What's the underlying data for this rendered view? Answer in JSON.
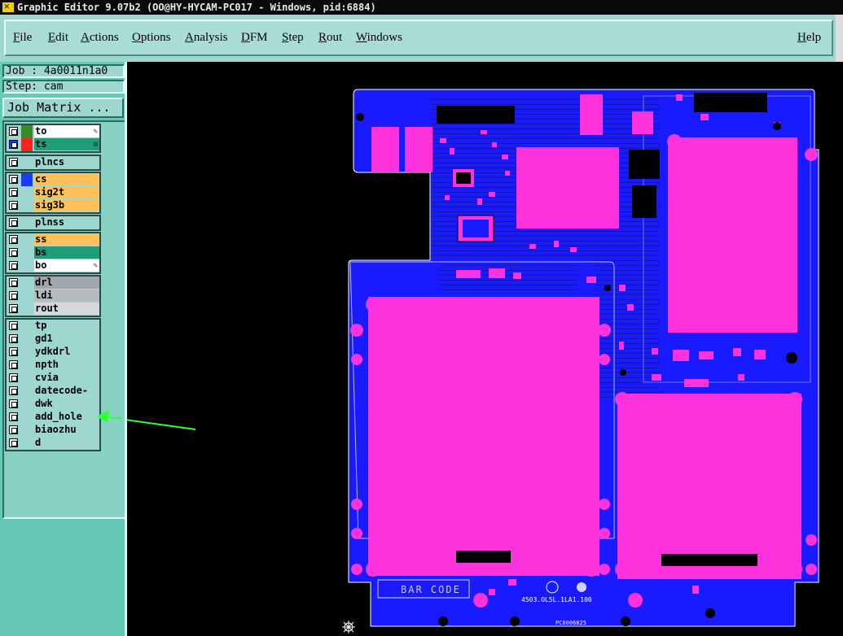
{
  "window": {
    "title": "Graphic Editor 9.07b2 (OO@HY-HYCAM-PC017 - Windows, pid:6884)"
  },
  "menu": {
    "items": [
      "File",
      "Edit",
      "Actions",
      "Options",
      "Analysis",
      "DFM",
      "Step",
      "Rout",
      "Windows"
    ],
    "help": "Help"
  },
  "panel": {
    "job": "Job : 4a0011n1a0",
    "step": "Step: cam",
    "job_matrix": "Job Matrix ..."
  },
  "layer_groups": [
    {
      "layers": [
        {
          "name": "to",
          "swatch": "#3a8a2a",
          "bg": "#ffffff",
          "mark": "✎"
        },
        {
          "name": "ts",
          "swatch": "#ff2020",
          "bg": "#1e9e78",
          "mark": "⊞",
          "selected": true
        }
      ]
    },
    {
      "layers": [
        {
          "name": "plncs",
          "swatch": "",
          "bg": "#9ed6d0"
        }
      ]
    },
    {
      "layers": [
        {
          "name": "cs",
          "swatch": "#1a3cff",
          "bg": "#ffc25a"
        },
        {
          "name": "sig2t",
          "swatch": "",
          "bg": "#ffc25a"
        },
        {
          "name": "sig3b",
          "swatch": "",
          "bg": "#ffc25a"
        }
      ]
    },
    {
      "layers": [
        {
          "name": "plnss",
          "swatch": "",
          "bg": "#9ed6d0"
        }
      ]
    },
    {
      "layers": [
        {
          "name": "ss",
          "swatch": "",
          "bg": "#ffc25a"
        },
        {
          "name": "bs",
          "swatch": "",
          "bg": "#1e9e78"
        },
        {
          "name": "bo",
          "swatch": "",
          "bg": "#ffffff",
          "mark": "✎"
        }
      ]
    },
    {
      "layers": [
        {
          "name": "drl",
          "swatch": "",
          "bg": "#9ea8ac"
        },
        {
          "name": "ldi",
          "swatch": "",
          "bg": "#b4bcc0"
        },
        {
          "name": "rout",
          "swatch": "",
          "bg": "#d4d8d8"
        }
      ]
    },
    {
      "layers": [
        {
          "name": "tp",
          "swatch": "",
          "bg": "#9ed6d0"
        },
        {
          "name": "gd1",
          "swatch": "",
          "bg": "#9ed6d0"
        },
        {
          "name": "ydkdrl",
          "swatch": "",
          "bg": "#9ed6d0"
        },
        {
          "name": "npth",
          "swatch": "",
          "bg": "#9ed6d0"
        },
        {
          "name": "cvia",
          "swatch": "",
          "bg": "#9ed6d0"
        },
        {
          "name": "datecode-to",
          "swatch": "",
          "bg": "#9ed6d0"
        },
        {
          "name": "dwk",
          "swatch": "",
          "bg": "#9ed6d0"
        },
        {
          "name": "add_hole",
          "swatch": "",
          "bg": "#9ed6d0"
        },
        {
          "name": "biaozhu",
          "swatch": "",
          "bg": "#9ed6d0"
        },
        {
          "name": "d",
          "swatch": "",
          "bg": "#9ed6d0"
        }
      ]
    }
  ],
  "board": {
    "barcode_label": "BAR CODE",
    "part_number": "4503.OL5L.1LA1.100",
    "sub_text": "PC8006825",
    "colors": {
      "board": "#1a1aff",
      "pad": "#ff33dd",
      "outline": "#ffffff",
      "annotation_arrow": "#33ff33"
    }
  }
}
